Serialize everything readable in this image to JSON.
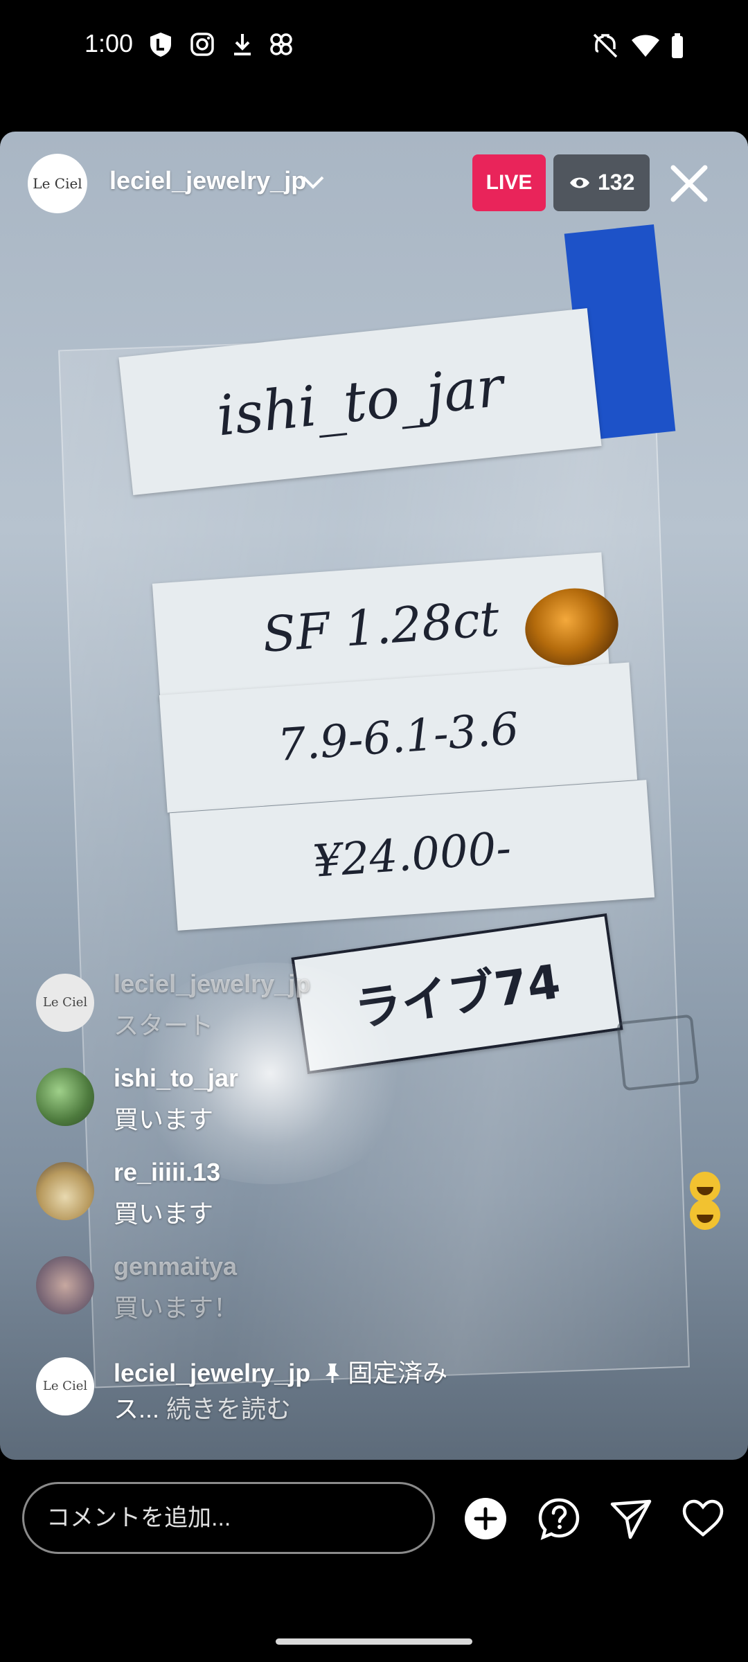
{
  "status_bar": {
    "time": "1:00",
    "left_icons": [
      "shield-l-icon",
      "instagram-icon",
      "download-icon",
      "pinwheel-icon"
    ],
    "right_icons": [
      "mute-icon",
      "wifi-icon",
      "battery-icon"
    ]
  },
  "header": {
    "host_avatar_text": "Le Ciel",
    "host_name": "leciel_jewelry_jp",
    "live_label": "LIVE",
    "viewer_count": "132"
  },
  "video": {
    "label_top": "ishi_to_jar",
    "label_line1": "SF 1.28ct",
    "label_line2": "7.9-6.1-3.6",
    "label_line3": "¥24.000-",
    "label_live": "ライブ74"
  },
  "comments": [
    {
      "user": "leciel_jewelry_jp",
      "text": "スタート",
      "avatar": "Le Ciel",
      "faded": true
    },
    {
      "user": "ishi_to_jar",
      "text": "買います",
      "avatar": ""
    },
    {
      "user": "re_iiiii.13",
      "text": "買います",
      "avatar": ""
    },
    {
      "user": "genmaitya",
      "text": "買います！",
      "avatar": "",
      "faded": true
    }
  ],
  "pinned_comment": {
    "user": "leciel_jewelry_jp",
    "pinned_label": "固定済み",
    "text": "ス...",
    "read_more": "続きを読む",
    "avatar": "Le Ciel"
  },
  "bottom_bar": {
    "comment_placeholder": "コメントを追加..."
  }
}
